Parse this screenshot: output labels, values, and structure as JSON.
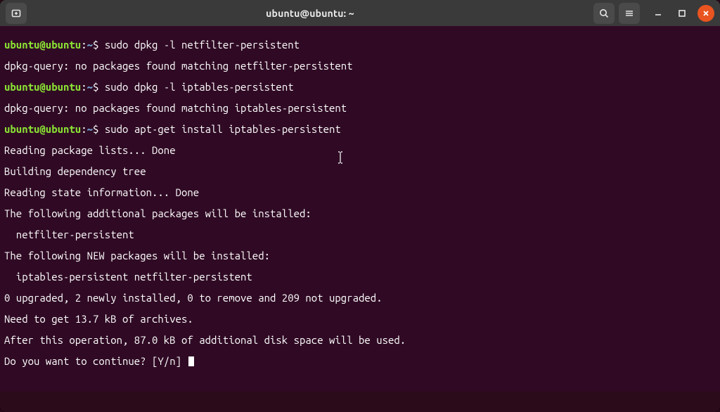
{
  "titlebar": {
    "title": "ubuntu@ubuntu: ~",
    "new_tab_icon": "new-tab-icon",
    "search_icon": "search-icon",
    "menu_icon": "hamburger-icon",
    "minimize_label": "—",
    "maximize_icon": "maximize-icon",
    "close_icon": "close-icon"
  },
  "prompt": {
    "userhost": "ubuntu@ubuntu",
    "path": "~",
    "sep1": ":",
    "sep2": "$ "
  },
  "commands": [
    "sudo dpkg -l netfilter-persistent",
    "sudo dpkg -l iptables-persistent",
    "sudo apt-get install iptables-persistent"
  ],
  "outputs": {
    "o1": "dpkg-query: no packages found matching netfilter-persistent",
    "o2": "dpkg-query: no packages found matching iptables-persistent",
    "o3": "Reading package lists... Done",
    "o4": "Building dependency tree",
    "o5": "Reading state information... Done",
    "o6": "The following additional packages will be installed:",
    "o7": "  netfilter-persistent",
    "o8": "The following NEW packages will be installed:",
    "o9": "  iptables-persistent netfilter-persistent",
    "o10": "0 upgraded, 2 newly installed, 0 to remove and 209 not upgraded.",
    "o11": "Need to get 13.7 kB of archives.",
    "o12": "After this operation, 87.0 kB of additional disk space will be used.",
    "o13": "Do you want to continue? [Y/n] "
  }
}
